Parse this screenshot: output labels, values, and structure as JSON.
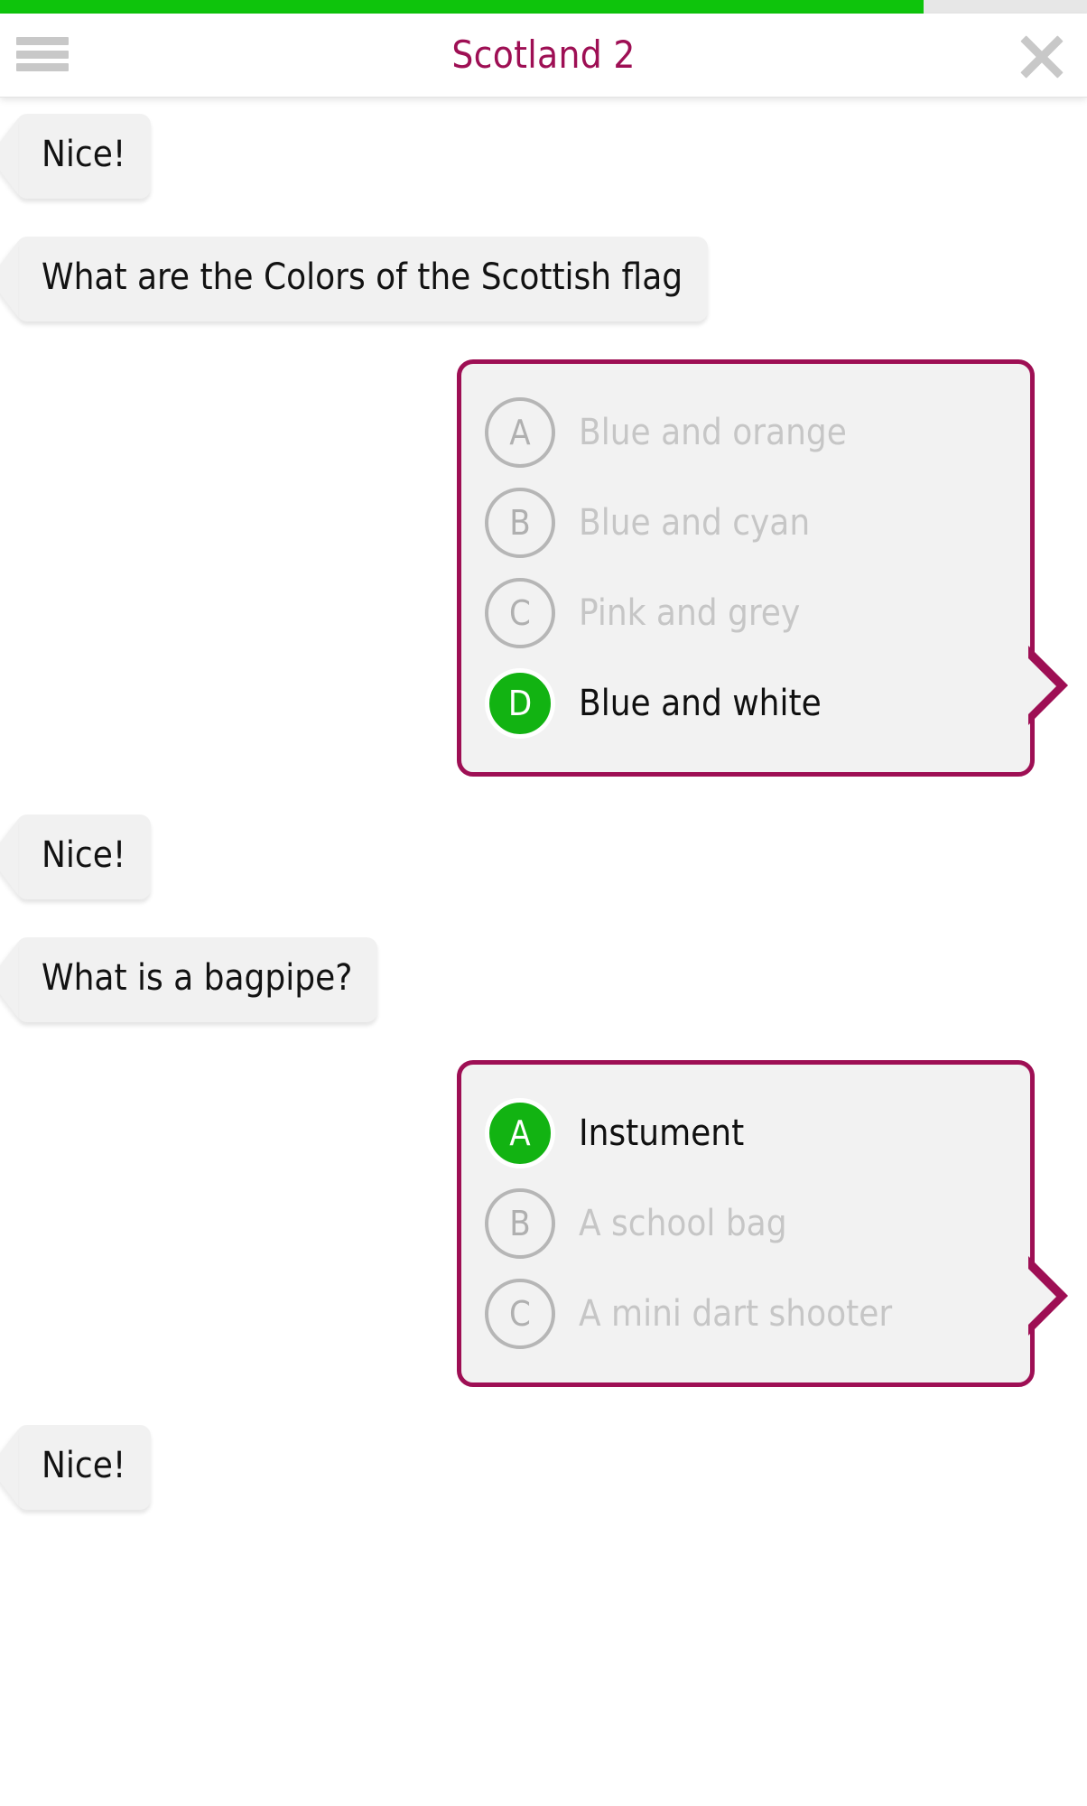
{
  "header": {
    "title": "Scotland 2",
    "menu_icon": "hamburger-menu-icon",
    "close_icon": "close-x-icon",
    "progress_percent": 85,
    "progress_color": "#0ec40c",
    "title_color": "#9e0f54"
  },
  "theme": {
    "accent": "#9e0f54",
    "selected_green": "#12b312",
    "bubble_bg": "#f1f1f1",
    "card_bg": "#f2f2f2",
    "inactive_text": "#c6c6c6",
    "inactive_outline": "#b6b6b6"
  },
  "messages": [
    {
      "kind": "bot",
      "text": "Nice!"
    },
    {
      "kind": "bot",
      "text": "What are the Colors of the Scottish flag"
    },
    {
      "kind": "answer-card",
      "options": [
        {
          "letter": "A",
          "label": "Blue and orange",
          "selected": false
        },
        {
          "letter": "B",
          "label": "Blue and cyan",
          "selected": false
        },
        {
          "letter": "C",
          "label": "Pink and grey",
          "selected": false
        },
        {
          "letter": "D",
          "label": "Blue and white",
          "selected": true
        }
      ]
    },
    {
      "kind": "bot",
      "text": "Nice!"
    },
    {
      "kind": "bot",
      "text": "What is a bagpipe?"
    },
    {
      "kind": "answer-card",
      "options": [
        {
          "letter": "A",
          "label": "Instument",
          "selected": true
        },
        {
          "letter": "B",
          "label": "A school bag",
          "selected": false
        },
        {
          "letter": "C",
          "label": "A mini dart shooter",
          "selected": false
        }
      ]
    },
    {
      "kind": "bot",
      "text": "Nice!"
    }
  ]
}
